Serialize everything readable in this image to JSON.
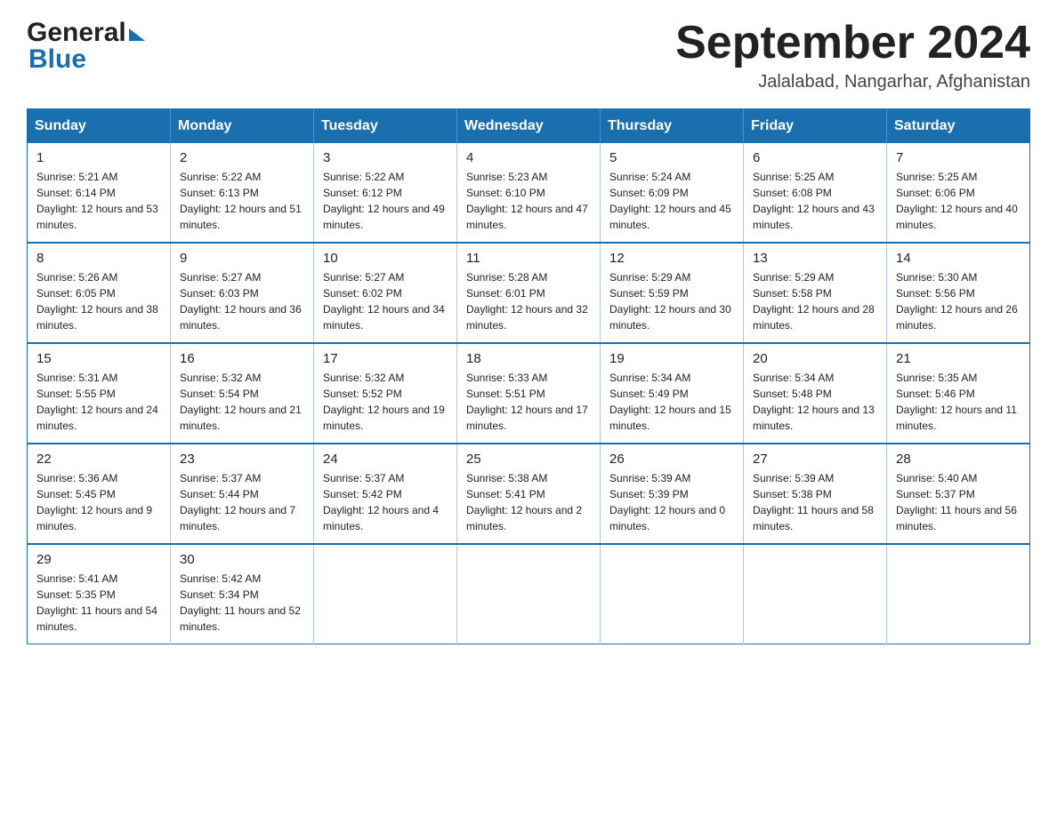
{
  "header": {
    "logo_general": "General",
    "logo_blue": "Blue",
    "month_title": "September 2024",
    "location": "Jalalabad, Nangarhar, Afghanistan"
  },
  "weekdays": [
    "Sunday",
    "Monday",
    "Tuesday",
    "Wednesday",
    "Thursday",
    "Friday",
    "Saturday"
  ],
  "weeks": [
    [
      {
        "day": "1",
        "sunrise": "5:21 AM",
        "sunset": "6:14 PM",
        "daylight": "12 hours and 53 minutes."
      },
      {
        "day": "2",
        "sunrise": "5:22 AM",
        "sunset": "6:13 PM",
        "daylight": "12 hours and 51 minutes."
      },
      {
        "day": "3",
        "sunrise": "5:22 AM",
        "sunset": "6:12 PM",
        "daylight": "12 hours and 49 minutes."
      },
      {
        "day": "4",
        "sunrise": "5:23 AM",
        "sunset": "6:10 PM",
        "daylight": "12 hours and 47 minutes."
      },
      {
        "day": "5",
        "sunrise": "5:24 AM",
        "sunset": "6:09 PM",
        "daylight": "12 hours and 45 minutes."
      },
      {
        "day": "6",
        "sunrise": "5:25 AM",
        "sunset": "6:08 PM",
        "daylight": "12 hours and 43 minutes."
      },
      {
        "day": "7",
        "sunrise": "5:25 AM",
        "sunset": "6:06 PM",
        "daylight": "12 hours and 40 minutes."
      }
    ],
    [
      {
        "day": "8",
        "sunrise": "5:26 AM",
        "sunset": "6:05 PM",
        "daylight": "12 hours and 38 minutes."
      },
      {
        "day": "9",
        "sunrise": "5:27 AM",
        "sunset": "6:03 PM",
        "daylight": "12 hours and 36 minutes."
      },
      {
        "day": "10",
        "sunrise": "5:27 AM",
        "sunset": "6:02 PM",
        "daylight": "12 hours and 34 minutes."
      },
      {
        "day": "11",
        "sunrise": "5:28 AM",
        "sunset": "6:01 PM",
        "daylight": "12 hours and 32 minutes."
      },
      {
        "day": "12",
        "sunrise": "5:29 AM",
        "sunset": "5:59 PM",
        "daylight": "12 hours and 30 minutes."
      },
      {
        "day": "13",
        "sunrise": "5:29 AM",
        "sunset": "5:58 PM",
        "daylight": "12 hours and 28 minutes."
      },
      {
        "day": "14",
        "sunrise": "5:30 AM",
        "sunset": "5:56 PM",
        "daylight": "12 hours and 26 minutes."
      }
    ],
    [
      {
        "day": "15",
        "sunrise": "5:31 AM",
        "sunset": "5:55 PM",
        "daylight": "12 hours and 24 minutes."
      },
      {
        "day": "16",
        "sunrise": "5:32 AM",
        "sunset": "5:54 PM",
        "daylight": "12 hours and 21 minutes."
      },
      {
        "day": "17",
        "sunrise": "5:32 AM",
        "sunset": "5:52 PM",
        "daylight": "12 hours and 19 minutes."
      },
      {
        "day": "18",
        "sunrise": "5:33 AM",
        "sunset": "5:51 PM",
        "daylight": "12 hours and 17 minutes."
      },
      {
        "day": "19",
        "sunrise": "5:34 AM",
        "sunset": "5:49 PM",
        "daylight": "12 hours and 15 minutes."
      },
      {
        "day": "20",
        "sunrise": "5:34 AM",
        "sunset": "5:48 PM",
        "daylight": "12 hours and 13 minutes."
      },
      {
        "day": "21",
        "sunrise": "5:35 AM",
        "sunset": "5:46 PM",
        "daylight": "12 hours and 11 minutes."
      }
    ],
    [
      {
        "day": "22",
        "sunrise": "5:36 AM",
        "sunset": "5:45 PM",
        "daylight": "12 hours and 9 minutes."
      },
      {
        "day": "23",
        "sunrise": "5:37 AM",
        "sunset": "5:44 PM",
        "daylight": "12 hours and 7 minutes."
      },
      {
        "day": "24",
        "sunrise": "5:37 AM",
        "sunset": "5:42 PM",
        "daylight": "12 hours and 4 minutes."
      },
      {
        "day": "25",
        "sunrise": "5:38 AM",
        "sunset": "5:41 PM",
        "daylight": "12 hours and 2 minutes."
      },
      {
        "day": "26",
        "sunrise": "5:39 AM",
        "sunset": "5:39 PM",
        "daylight": "12 hours and 0 minutes."
      },
      {
        "day": "27",
        "sunrise": "5:39 AM",
        "sunset": "5:38 PM",
        "daylight": "11 hours and 58 minutes."
      },
      {
        "day": "28",
        "sunrise": "5:40 AM",
        "sunset": "5:37 PM",
        "daylight": "11 hours and 56 minutes."
      }
    ],
    [
      {
        "day": "29",
        "sunrise": "5:41 AM",
        "sunset": "5:35 PM",
        "daylight": "11 hours and 54 minutes."
      },
      {
        "day": "30",
        "sunrise": "5:42 AM",
        "sunset": "5:34 PM",
        "daylight": "11 hours and 52 minutes."
      },
      null,
      null,
      null,
      null,
      null
    ]
  ],
  "labels": {
    "sunrise_prefix": "Sunrise: ",
    "sunset_prefix": "Sunset: ",
    "daylight_prefix": "Daylight: "
  }
}
